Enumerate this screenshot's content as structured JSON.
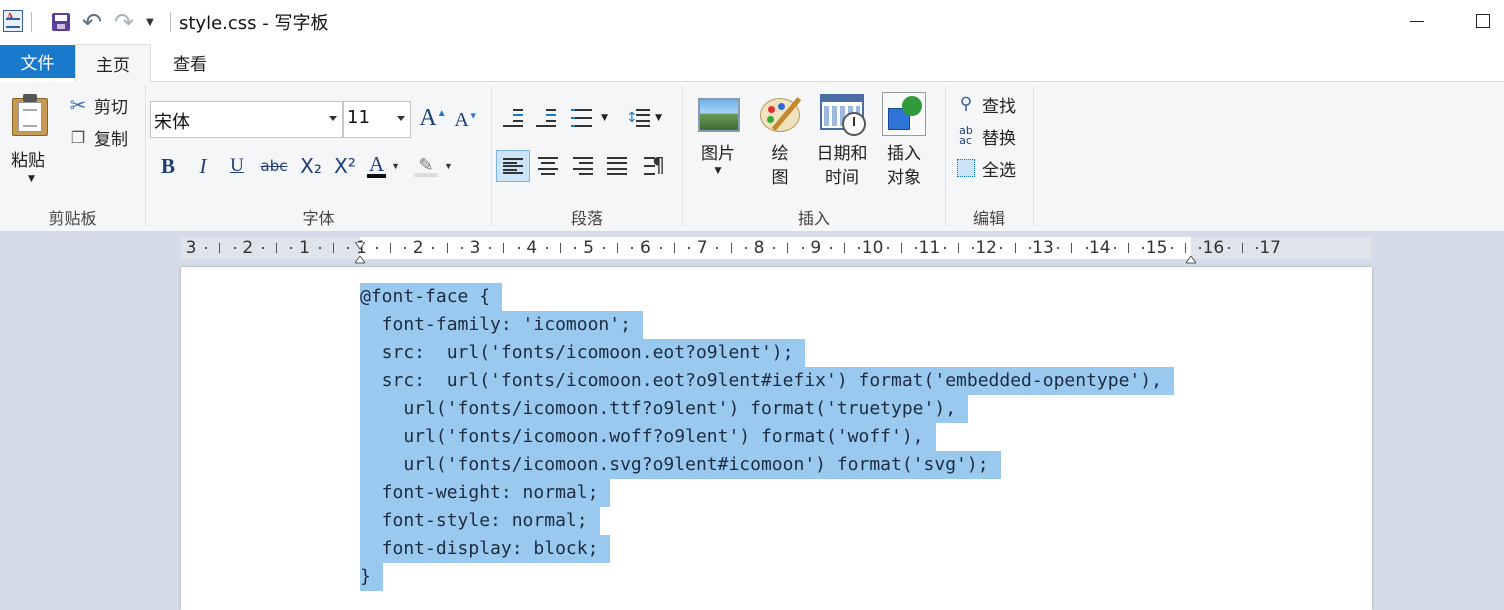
{
  "window": {
    "title": "style.css - 写字板"
  },
  "tabs": [
    {
      "label": "文件"
    },
    {
      "label": "主页"
    },
    {
      "label": "查看"
    }
  ],
  "ribbon": {
    "clipboard": {
      "paste": "粘贴",
      "cut": "剪切",
      "copy": "复制",
      "group": "剪贴板"
    },
    "font": {
      "family": "宋体",
      "size": "11",
      "group": "字体",
      "bold": "B",
      "italic": "I",
      "underline": "U",
      "strike": "abc",
      "subscript": "X₂",
      "superscript": "X²",
      "font_color": "A"
    },
    "paragraph": {
      "group": "段落",
      "selected_alignment": "left"
    },
    "insert": {
      "group": "插入",
      "picture": "图片",
      "paint_line1": "绘",
      "paint_line2": "图",
      "datetime_line1": "日期和",
      "datetime_line2": "时间",
      "object_line1": "插入",
      "object_line2": "对象"
    },
    "editing": {
      "group": "编辑",
      "find": "查找",
      "replace": "替换",
      "select_all": "全选"
    }
  },
  "ruler": {
    "labels": [
      "3",
      "2",
      "1",
      "1",
      "2",
      "3",
      "4",
      "5",
      "6",
      "7",
      "8",
      "9",
      "10",
      "11",
      "12",
      "13",
      "14",
      "15",
      "16",
      "17"
    ]
  },
  "document": {
    "lines": [
      "@font-face {",
      "  font-family: 'icomoon';",
      "  src:  url('fonts/icomoon.eot?o9lent');",
      "  src:  url('fonts/icomoon.eot?o9lent#iefix') format('embedded-opentype'),",
      "    url('fonts/icomoon.ttf?o9lent') format('truetype'),",
      "    url('fonts/icomoon.woff?o9lent') format('woff'),",
      "    url('fonts/icomoon.svg?o9lent#icomoon') format('svg');",
      "  font-weight: normal;",
      "  font-style: normal;",
      "  font-display: block;",
      "}"
    ],
    "selection_color": "#99c9ef"
  },
  "colors": {
    "file_tab": "#1979ca",
    "ribbon_bg": "#f5f6f7",
    "workspace_bg": "#d6dbe9"
  }
}
